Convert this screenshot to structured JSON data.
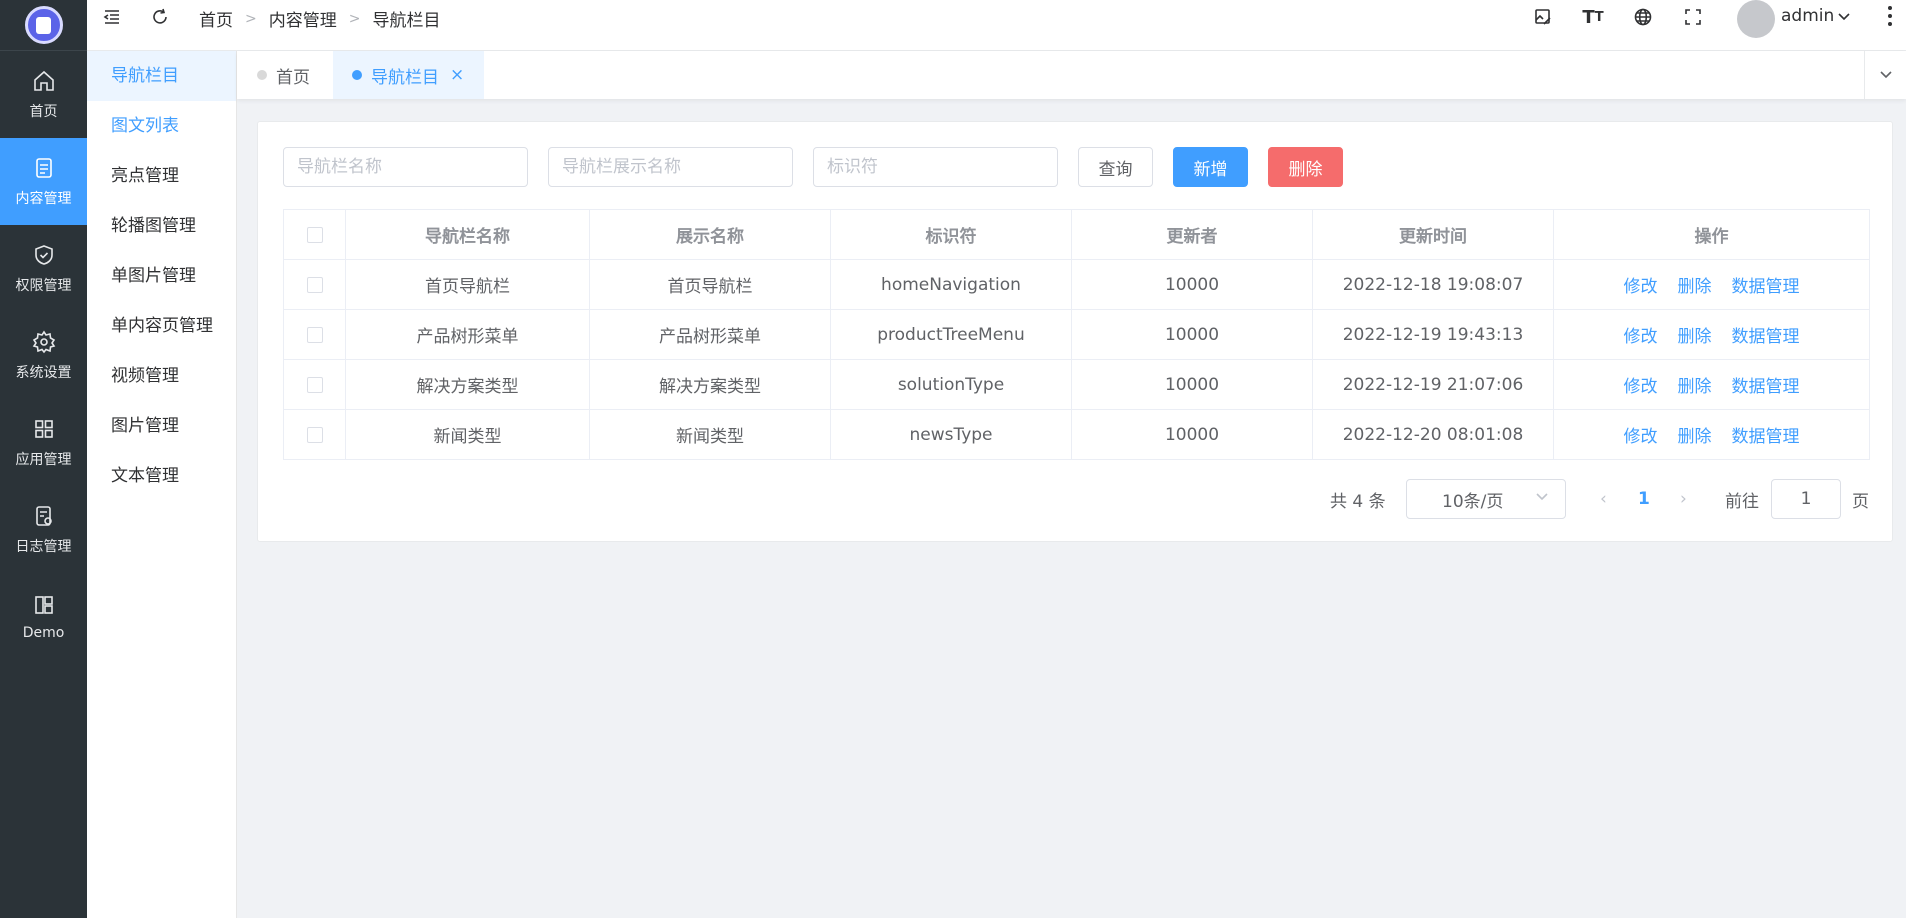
{
  "rail": {
    "items": [
      {
        "label": "首页",
        "icon": "home-icon"
      },
      {
        "label": "内容管理",
        "icon": "document-icon",
        "active": true
      },
      {
        "label": "权限管理",
        "icon": "shield-icon"
      },
      {
        "label": "系统设置",
        "icon": "gear-icon"
      },
      {
        "label": "应用管理",
        "icon": "grid-icon"
      },
      {
        "label": "日志管理",
        "icon": "log-icon"
      },
      {
        "label": "Demo",
        "icon": "layout-icon"
      }
    ]
  },
  "submenu": {
    "items": [
      "导航栏目",
      "图文列表",
      "亮点管理",
      "轮播图管理",
      "单图片管理",
      "单内容页管理",
      "视频管理",
      "图片管理",
      "文本管理"
    ]
  },
  "header": {
    "breadcrumb": [
      "首页",
      "内容管理",
      "导航栏目"
    ],
    "username": "admin"
  },
  "tabs": [
    {
      "label": "首页"
    },
    {
      "label": "导航栏目",
      "active": true
    }
  ],
  "search": {
    "name_placeholder": "导航栏名称",
    "display_placeholder": "导航栏展示名称",
    "identifier_placeholder": "标识符",
    "query_label": "查询",
    "add_label": "新增",
    "delete_label": "删除"
  },
  "table": {
    "headers": [
      "导航栏名称",
      "展示名称",
      "标识符",
      "更新者",
      "更新时间",
      "操作"
    ],
    "rows": [
      {
        "name": "首页导航栏",
        "display": "首页导航栏",
        "identifier": "homeNavigation",
        "updater": "10000",
        "time": "2022-12-18 19:08:07"
      },
      {
        "name": "产品树形菜单",
        "display": "产品树形菜单",
        "identifier": "productTreeMenu",
        "updater": "10000",
        "time": "2022-12-19 19:43:13"
      },
      {
        "name": "解决方案类型",
        "display": "解决方案类型",
        "identifier": "solutionType",
        "updater": "10000",
        "time": "2022-12-19 21:07:06"
      },
      {
        "name": "新闻类型",
        "display": "新闻类型",
        "identifier": "newsType",
        "updater": "10000",
        "time": "2022-12-20 08:01:08"
      }
    ],
    "actions": {
      "edit": "修改",
      "delete": "删除",
      "data": "数据管理"
    }
  },
  "pagination": {
    "total": "共 4 条",
    "page_size": "10条/页",
    "current": "1",
    "goto_label": "前往",
    "goto_value": "1",
    "page_suffix": "页"
  },
  "colors": {
    "primary": "#409eff",
    "danger": "#f56c6c",
    "rail_bg": "#2b3338"
  }
}
